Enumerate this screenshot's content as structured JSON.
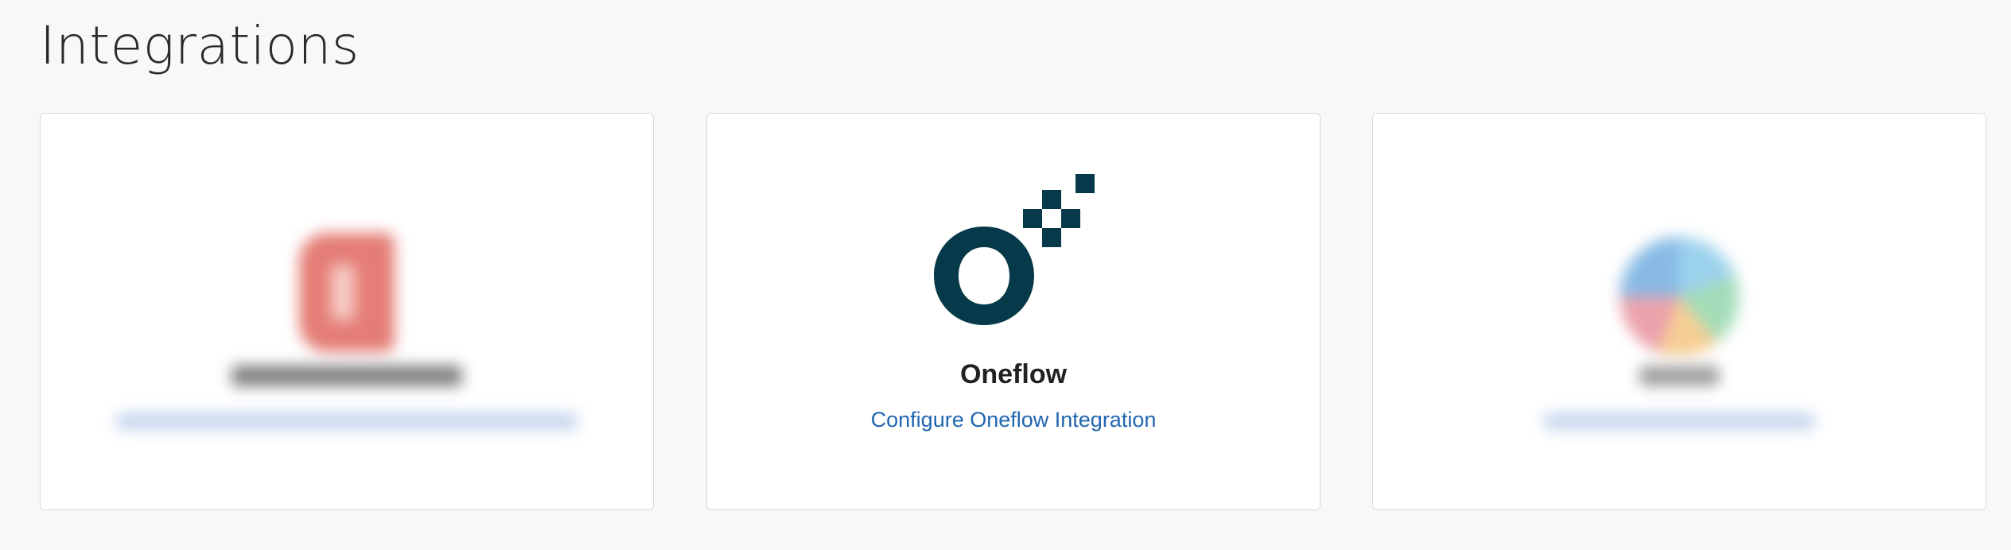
{
  "page": {
    "title": "Integrations"
  },
  "cards": [
    {
      "name": "",
      "link": "",
      "logo_icon": "office-icon",
      "blurred": true
    },
    {
      "name": "Oneflow",
      "link": "Configure Oneflow Integration",
      "logo_icon": "oneflow-logo",
      "blurred": false,
      "brand_color": "#063a4a"
    },
    {
      "name": "",
      "link": "",
      "logo_icon": "color-wheel-icon",
      "blurred": true
    }
  ],
  "colors": {
    "background": "#f7f8fa",
    "card_background": "#ffffff",
    "card_border": "#d6d9de",
    "link": "#1f65b0",
    "heading": "#2a2a2a"
  }
}
